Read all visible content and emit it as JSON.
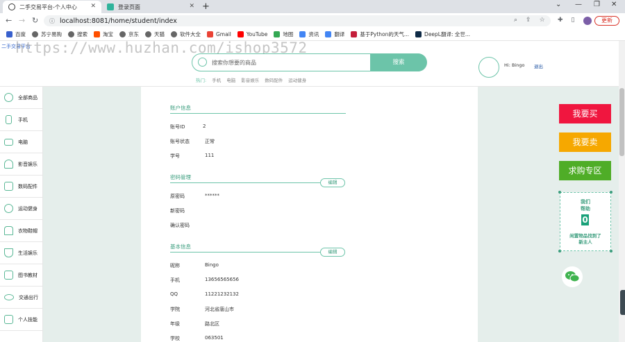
{
  "browser": {
    "tabs": [
      {
        "title": "二手交易平台-个人中心",
        "active": true
      },
      {
        "title": "登录页面",
        "active": false
      }
    ],
    "url": "localhost:8081/home/student/index",
    "update_label": "更新",
    "bookmarks": [
      "百度",
      "苏宁易购",
      "搜索",
      "淘宝",
      "京东",
      "天猫",
      "软件大全",
      "Gmail",
      "YouTube",
      "地图",
      "资讯",
      "翻译",
      "基于Python的天气...",
      "DeepL翻译: 全世..."
    ]
  },
  "header": {
    "logo_alt": "二手交易平台",
    "watermark": "https://www.huzhan.com/ishop3572",
    "search_placeholder": "搜索你想要的商品",
    "search_button": "搜索",
    "hot_label": "热门:",
    "hot_items": [
      "手机",
      "电脑",
      "影音娱乐",
      "数码配件",
      "运动健身"
    ],
    "greeting": "Hi:  Bingo",
    "logout": "退出"
  },
  "sidebar": {
    "items": [
      {
        "label": "全部商品",
        "icon": "plus-circle-icon"
      },
      {
        "label": "手机",
        "icon": "phone-icon"
      },
      {
        "label": "电脑",
        "icon": "monitor-icon"
      },
      {
        "label": "影音娱乐",
        "icon": "headphones-icon"
      },
      {
        "label": "数码配件",
        "icon": "camera-icon"
      },
      {
        "label": "运动健身",
        "icon": "ball-icon"
      },
      {
        "label": "衣物鞋帽",
        "icon": "shirt-icon"
      },
      {
        "label": "生活娱乐",
        "icon": "glass-icon"
      },
      {
        "label": "图书教材",
        "icon": "book-icon"
      },
      {
        "label": "交通出行",
        "icon": "bike-icon"
      },
      {
        "label": "个人技能",
        "icon": "tv-icon"
      }
    ]
  },
  "account": {
    "title": "账户信息",
    "rows": [
      {
        "label": "账号ID",
        "value": "2"
      },
      {
        "label": "账号状态",
        "value": "正常"
      },
      {
        "label": "学号",
        "value": "111"
      }
    ]
  },
  "password": {
    "title": "密码管理",
    "edit": "编辑",
    "rows": [
      {
        "label": "原密码",
        "value": "******"
      },
      {
        "label": "新密码",
        "value": ""
      },
      {
        "label": "确认密码",
        "value": ""
      }
    ]
  },
  "basic": {
    "title": "基本信息",
    "edit": "编辑",
    "rows": [
      {
        "label": "昵称",
        "value": "Bingo"
      },
      {
        "label": "手机",
        "value": "13656565656"
      },
      {
        "label": "QQ",
        "value": "11221232132"
      },
      {
        "label": "学院",
        "value": "河北省唐山市"
      },
      {
        "label": "年级",
        "value": "路北区"
      },
      {
        "label": "学校",
        "value": "063501"
      }
    ]
  },
  "actions": {
    "buy": "我要买",
    "sell": "我要卖",
    "want": "求购专区"
  },
  "help": {
    "title_line1": "我们",
    "title_line2": "帮助",
    "count": "0",
    "foot_line1": "闲置物品找到了",
    "foot_line2": "新主人"
  },
  "colors": {
    "accent": "#6cc4a9",
    "buy": "#f0163f",
    "sell": "#f6a800",
    "want": "#4fad27",
    "main_bg": "#e5eeeb"
  }
}
